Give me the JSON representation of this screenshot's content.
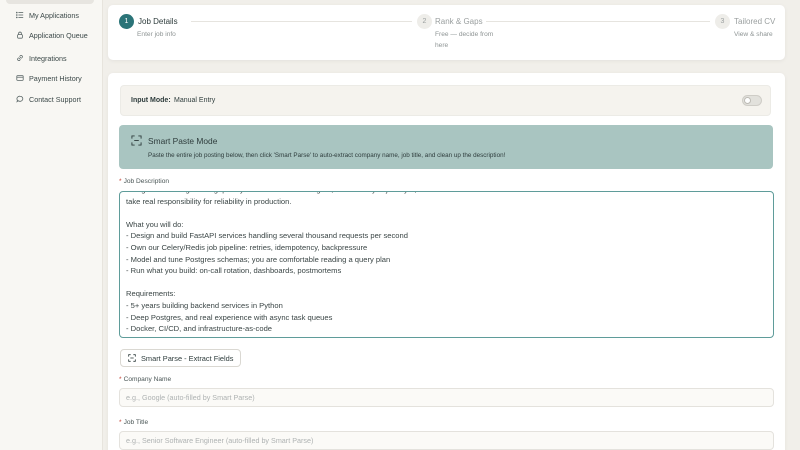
{
  "sidebar": {
    "items": [
      {
        "label": "My Applications",
        "icon": "list-icon"
      },
      {
        "label": "Application Queue",
        "icon": "lock-icon"
      },
      {
        "label": "Integrations",
        "icon": "link-icon"
      },
      {
        "label": "Payment History",
        "icon": "card-icon"
      },
      {
        "label": "Contact Support",
        "icon": "chat-icon"
      }
    ]
  },
  "stepper": {
    "steps": [
      {
        "number": "1",
        "title": "Job Details",
        "subtitle": "Enter job info"
      },
      {
        "number": "2",
        "title": "Rank & Gaps",
        "subtitle_line1": "Free — decide from",
        "subtitle_line2": "here"
      },
      {
        "number": "3",
        "title": "Tailored CV",
        "subtitle": "View & share"
      }
    ]
  },
  "input_mode": {
    "label": "Input Mode:",
    "value": "Manual Entry"
  },
  "smart_paste": {
    "title": "Smart Paste Mode",
    "description": "Paste the entire job posting below, then click 'Smart Parse' to auto-extract company name, job title, and clean up the description!"
  },
  "job_description": {
    "label": "Job Description",
    "value": "Design and run high-throughput Python services on Postgres, own the async job layer, and\ntake real responsibility for reliability in production.\n\nWhat you will do:\n- Design and build FastAPI services handling several thousand requests per second\n- Own our Celery/Redis job pipeline: retries, idempotency, backpressure\n- Model and tune Postgres schemas; you are comfortable reading a query plan\n- Run what you build: on-call rotation, dashboards, postmortems\n\nRequirements:\n- 5+ years building backend services in Python\n- Deep Postgres, and real experience with async task queues\n- Docker, CI/CD, and infrastructure-as-code"
  },
  "smart_parse_button": {
    "label": "Smart Parse - Extract Fields"
  },
  "company_name": {
    "label": "Company Name",
    "placeholder": "e.g., Google (auto-filled by Smart Parse)"
  },
  "job_title": {
    "label": "Job Title",
    "placeholder": "e.g., Senior Software Engineer (auto-filled by Smart Parse)"
  },
  "colors": {
    "accent": "#2b7478",
    "smart_paste_bg": "#a9c5c1",
    "page_bg": "#f1efea"
  }
}
